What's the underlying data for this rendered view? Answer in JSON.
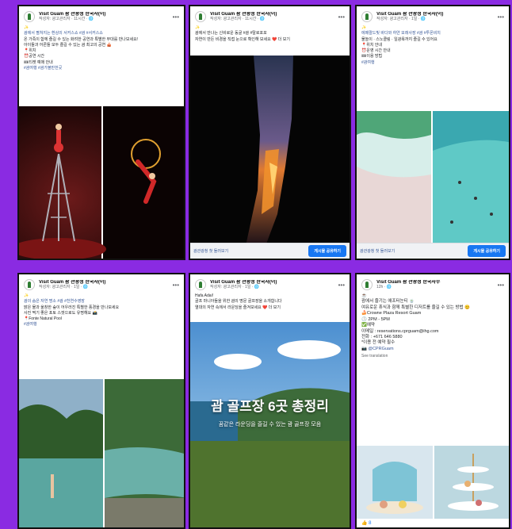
{
  "colors": {
    "background": "#8a2be2",
    "cta_blue": "#1877f2",
    "link": "#385898"
  },
  "page_name": "Visit Guam 괌 관광청 한국사무소",
  "cards": [
    {
      "page_name": "Visit Guam 괌 관광청 한국사(이)",
      "meta": "작성자: 광고관리자 · 11시간 · 🌐",
      "lines": [
        "✨",
        "괌에서 펼쳐지는 환상의 서커스쇼 #괌 #서커스쇼",
        "온 가족이 함께 즐길 수 있는 화려한 공연과 특별한 무대를 만나보세요!",
        "아이들과 어른들 모두 즐길 수 있는 괌 최고의 공연 🎪",
        "📍위치",
        "⏰공연 시간",
        "🎟티켓 예매 안내",
        "#괌여행 #괌가볼만한곳"
      ]
    },
    {
      "page_name": "Visit Guam 괌 관광청 한국사(이)",
      "meta": "작성자: 광고관리자 · 11시간 · 🌐",
      "lines": [
        "✨",
        "괌에서 만나는 신비로운 동굴 #괌 #탈로포포",
        "자연이 만든 비경을 직접 눈으로 확인해 보세요 ❤️ 더 보기"
      ],
      "cta_text": "괌관광청 첫 둘러보기",
      "cta_button": "게시물 공유하기"
    },
    {
      "page_name": "Visit Guam 괌 관광청 한국사(이)",
      "meta": "작성자: 광고관리자 · 1일 · 🌐",
      "lines": [
        "✨",
        "에메랄드빛 바다와 하얀 모래사장 #괌 #투몬비치",
        "물놀이 · 스노클링 · 일광욕까지 즐길 수 있어요",
        "📍위치 안내",
        "⏰운영 시간 안내",
        "🎟이용 방법",
        "#괌여행"
      ],
      "cta_text": "괌관광청 첫 둘러보기",
      "cta_button": "게시물 공유하기"
    },
    {
      "page_name": "Visit Guam 괌 관광청 한국사(이)",
      "meta": "작성자: 광고관리자 · 1일 · 🌐",
      "lines": [
        "✨",
        "괌의 숨은 자연 명소 #괌 #천연수영장",
        "맑은 물과 울창한 숲이 어우러진 특별한 풍경을 만나보세요",
        "사진 찍기 좋은 포토 스팟으로도 유명해요 📸",
        "📍Fonte Natural Pool",
        "#괌여행"
      ]
    },
    {
      "page_name": "Visit Guam 괌 관광청 한국사(이)",
      "meta": "작성자: 광고관리자 · 1일 · 🌐",
      "lines": [
        "Hafa Adai!",
        "골프 마니아들을 위한 괌의 명문 골프장을 소개합니다",
        "열대의 자연 속에서 라운딩을 즐겨보세요 ❤️ 더 보기"
      ],
      "overlay_title": "괌 골프장 6곳 총정리",
      "overlay_subtitle": "꿈같은 라운딩을 즐길 수 있는 괌 골프장 모음"
    },
    {
      "page_name": "Visit Guam 괌 관광청 한국사무",
      "meta": "12h · 🌐",
      "lines": [
        "☕",
        "괌에서 즐기는 애프터눈티 🍵",
        "",
        "여유로운 휴식과 함께 특별한 디저트를 즐길 수 있는 방법 😊",
        "",
        "🍰Crowne Plaza Resort Guam",
        "",
        "🕒 2PM - 5PM",
        "",
        "✅예약",
        "이메일 : reservations.cprguam@ihg.com",
        "전화 : +671 646 5880",
        "*이용 전 예약 필수",
        "",
        "📷 @CPRGuam"
      ],
      "see_translation": "See translation",
      "reactions": "👍 8"
    }
  ]
}
